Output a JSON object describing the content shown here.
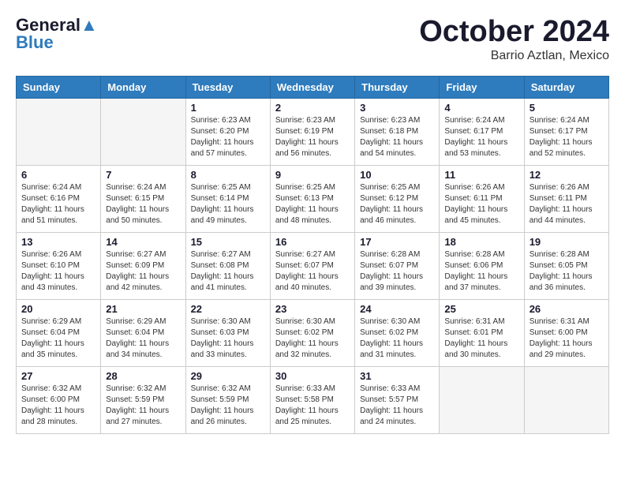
{
  "logo": {
    "line1": "General",
    "line2": "Blue"
  },
  "title": "October 2024",
  "subtitle": "Barrio Aztlan, Mexico",
  "days_header": [
    "Sunday",
    "Monday",
    "Tuesday",
    "Wednesday",
    "Thursday",
    "Friday",
    "Saturday"
  ],
  "weeks": [
    [
      {
        "day": "",
        "info": ""
      },
      {
        "day": "",
        "info": ""
      },
      {
        "day": "1",
        "info": "Sunrise: 6:23 AM\nSunset: 6:20 PM\nDaylight: 11 hours and 57 minutes."
      },
      {
        "day": "2",
        "info": "Sunrise: 6:23 AM\nSunset: 6:19 PM\nDaylight: 11 hours and 56 minutes."
      },
      {
        "day": "3",
        "info": "Sunrise: 6:23 AM\nSunset: 6:18 PM\nDaylight: 11 hours and 54 minutes."
      },
      {
        "day": "4",
        "info": "Sunrise: 6:24 AM\nSunset: 6:17 PM\nDaylight: 11 hours and 53 minutes."
      },
      {
        "day": "5",
        "info": "Sunrise: 6:24 AM\nSunset: 6:17 PM\nDaylight: 11 hours and 52 minutes."
      }
    ],
    [
      {
        "day": "6",
        "info": "Sunrise: 6:24 AM\nSunset: 6:16 PM\nDaylight: 11 hours and 51 minutes."
      },
      {
        "day": "7",
        "info": "Sunrise: 6:24 AM\nSunset: 6:15 PM\nDaylight: 11 hours and 50 minutes."
      },
      {
        "day": "8",
        "info": "Sunrise: 6:25 AM\nSunset: 6:14 PM\nDaylight: 11 hours and 49 minutes."
      },
      {
        "day": "9",
        "info": "Sunrise: 6:25 AM\nSunset: 6:13 PM\nDaylight: 11 hours and 48 minutes."
      },
      {
        "day": "10",
        "info": "Sunrise: 6:25 AM\nSunset: 6:12 PM\nDaylight: 11 hours and 46 minutes."
      },
      {
        "day": "11",
        "info": "Sunrise: 6:26 AM\nSunset: 6:11 PM\nDaylight: 11 hours and 45 minutes."
      },
      {
        "day": "12",
        "info": "Sunrise: 6:26 AM\nSunset: 6:11 PM\nDaylight: 11 hours and 44 minutes."
      }
    ],
    [
      {
        "day": "13",
        "info": "Sunrise: 6:26 AM\nSunset: 6:10 PM\nDaylight: 11 hours and 43 minutes."
      },
      {
        "day": "14",
        "info": "Sunrise: 6:27 AM\nSunset: 6:09 PM\nDaylight: 11 hours and 42 minutes."
      },
      {
        "day": "15",
        "info": "Sunrise: 6:27 AM\nSunset: 6:08 PM\nDaylight: 11 hours and 41 minutes."
      },
      {
        "day": "16",
        "info": "Sunrise: 6:27 AM\nSunset: 6:07 PM\nDaylight: 11 hours and 40 minutes."
      },
      {
        "day": "17",
        "info": "Sunrise: 6:28 AM\nSunset: 6:07 PM\nDaylight: 11 hours and 39 minutes."
      },
      {
        "day": "18",
        "info": "Sunrise: 6:28 AM\nSunset: 6:06 PM\nDaylight: 11 hours and 37 minutes."
      },
      {
        "day": "19",
        "info": "Sunrise: 6:28 AM\nSunset: 6:05 PM\nDaylight: 11 hours and 36 minutes."
      }
    ],
    [
      {
        "day": "20",
        "info": "Sunrise: 6:29 AM\nSunset: 6:04 PM\nDaylight: 11 hours and 35 minutes."
      },
      {
        "day": "21",
        "info": "Sunrise: 6:29 AM\nSunset: 6:04 PM\nDaylight: 11 hours and 34 minutes."
      },
      {
        "day": "22",
        "info": "Sunrise: 6:30 AM\nSunset: 6:03 PM\nDaylight: 11 hours and 33 minutes."
      },
      {
        "day": "23",
        "info": "Sunrise: 6:30 AM\nSunset: 6:02 PM\nDaylight: 11 hours and 32 minutes."
      },
      {
        "day": "24",
        "info": "Sunrise: 6:30 AM\nSunset: 6:02 PM\nDaylight: 11 hours and 31 minutes."
      },
      {
        "day": "25",
        "info": "Sunrise: 6:31 AM\nSunset: 6:01 PM\nDaylight: 11 hours and 30 minutes."
      },
      {
        "day": "26",
        "info": "Sunrise: 6:31 AM\nSunset: 6:00 PM\nDaylight: 11 hours and 29 minutes."
      }
    ],
    [
      {
        "day": "27",
        "info": "Sunrise: 6:32 AM\nSunset: 6:00 PM\nDaylight: 11 hours and 28 minutes."
      },
      {
        "day": "28",
        "info": "Sunrise: 6:32 AM\nSunset: 5:59 PM\nDaylight: 11 hours and 27 minutes."
      },
      {
        "day": "29",
        "info": "Sunrise: 6:32 AM\nSunset: 5:59 PM\nDaylight: 11 hours and 26 minutes."
      },
      {
        "day": "30",
        "info": "Sunrise: 6:33 AM\nSunset: 5:58 PM\nDaylight: 11 hours and 25 minutes."
      },
      {
        "day": "31",
        "info": "Sunrise: 6:33 AM\nSunset: 5:57 PM\nDaylight: 11 hours and 24 minutes."
      },
      {
        "day": "",
        "info": ""
      },
      {
        "day": "",
        "info": ""
      }
    ]
  ]
}
